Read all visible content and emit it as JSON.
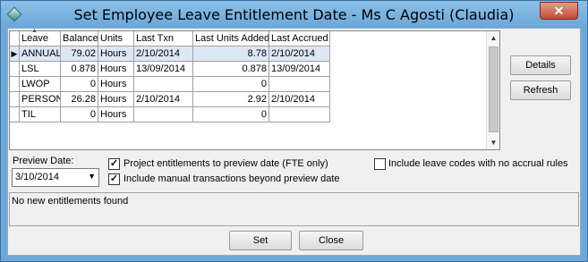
{
  "window": {
    "title": "Set Employee Leave Entitlement Date - Ms C Agosti (Claudia)",
    "close_glyph": "✕"
  },
  "grid": {
    "columns": [
      "Leave",
      "Balance",
      "Units",
      "Last Txn",
      "Last Units Added",
      "Last Accrued"
    ],
    "rows": [
      {
        "leave": "ANNUAL",
        "balance": "79.02",
        "units": "Hours",
        "last_txn": "2/10/2014",
        "last_units_added": "8.78",
        "last_accrued": "2/10/2014",
        "selected": true
      },
      {
        "leave": "LSL",
        "balance": "0.878",
        "units": "Hours",
        "last_txn": "13/09/2014",
        "last_units_added": "0.878",
        "last_accrued": "13/09/2014"
      },
      {
        "leave": "LWOP",
        "balance": "0",
        "units": "Hours",
        "last_txn": "",
        "last_units_added": "0",
        "last_accrued": ""
      },
      {
        "leave": "PERSON",
        "balance": "26.28",
        "units": "Hours",
        "last_txn": "2/10/2014",
        "last_units_added": "2.92",
        "last_accrued": "2/10/2014"
      },
      {
        "leave": "TIL",
        "balance": "0",
        "units": "Hours",
        "last_txn": "",
        "last_units_added": "0",
        "last_accrued": ""
      }
    ]
  },
  "side_buttons": {
    "details": "Details",
    "refresh": "Refresh"
  },
  "preview": {
    "label": "Preview Date:",
    "value": "3/10/2014"
  },
  "options": {
    "project_entitlements": {
      "label": "Project entitlements to preview date (FTE only)",
      "checked": true
    },
    "include_manual": {
      "label": "Include manual transactions beyond preview date",
      "checked": true
    },
    "include_no_accrual": {
      "label": "Include leave codes with no accrual rules",
      "checked": false
    }
  },
  "status": {
    "message": "No new entitlements found"
  },
  "footer": {
    "set": "Set",
    "close": "Close"
  },
  "icons": {
    "app": "diamond-icon",
    "close": "close-icon",
    "row_indicator": "row-pointer-icon",
    "sort": "sort-arrow-icon"
  },
  "colors": {
    "title_bar": "#6fa8d6",
    "selected_row": "#dde8f5",
    "close_button": "#c44a31"
  }
}
